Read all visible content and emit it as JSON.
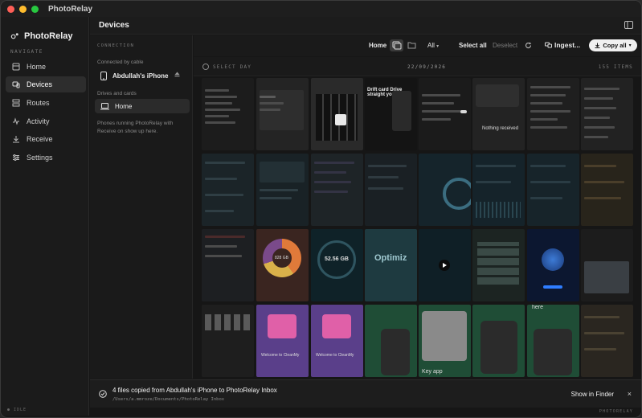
{
  "app": {
    "title": "PhotoRelay",
    "brand": "PhotoRelay"
  },
  "sidebar": {
    "section_label": "NAVIGATE",
    "items": [
      {
        "label": "Home",
        "icon": "home-icon",
        "active": false
      },
      {
        "label": "Devices",
        "icon": "devices-icon",
        "active": true
      },
      {
        "label": "Routes",
        "icon": "routes-icon",
        "active": false
      },
      {
        "label": "Activity",
        "icon": "activity-icon",
        "active": false
      },
      {
        "label": "Receive",
        "icon": "receive-icon",
        "active": false
      },
      {
        "label": "Settings",
        "icon": "settings-icon",
        "active": false
      }
    ],
    "status": "● IDLE"
  },
  "header": {
    "title": "Devices"
  },
  "connection": {
    "section_label": "CONNECTION",
    "cable_label": "Connected by cable",
    "device_name": "Abdullah's iPhone",
    "drives_label": "Drives and cards",
    "drive_name": "Home",
    "helper_text": "Phones running PhotoRelay with Receive on show up here."
  },
  "gallery_toolbar": {
    "location": "Home",
    "filter": "All",
    "select_all": "Select all",
    "deselect": "Deselect",
    "ingest": "Ingest...",
    "copy_all": "Copy all"
  },
  "day_header": {
    "select_day": "SELECT DAY",
    "date": "22/09/2026",
    "count": "155 ITEMS"
  },
  "tiles": {
    "drift": "Drift card Drive straight you brush.",
    "nothing": "Nothing received",
    "storage1": "828 GB",
    "storage2": "52.56 GB",
    "optimize": "Optimiz",
    "welcome": "Welcome to CleanMy",
    "here": "here",
    "keyapp": "Key app"
  },
  "toast": {
    "title": "4 files copied from Abdullah's iPhone to PhotoRelay Inbox",
    "path": "/Users/a.mmroze/Documents/PhotoRelay Inbox",
    "action": "Show in Finder",
    "close": "×"
  },
  "footer": {
    "brand": "PHOTORELAY"
  },
  "colors": {
    "accent": "#2f7dff",
    "active_bg": "#2d2d2d",
    "green": "#1f4d36"
  }
}
